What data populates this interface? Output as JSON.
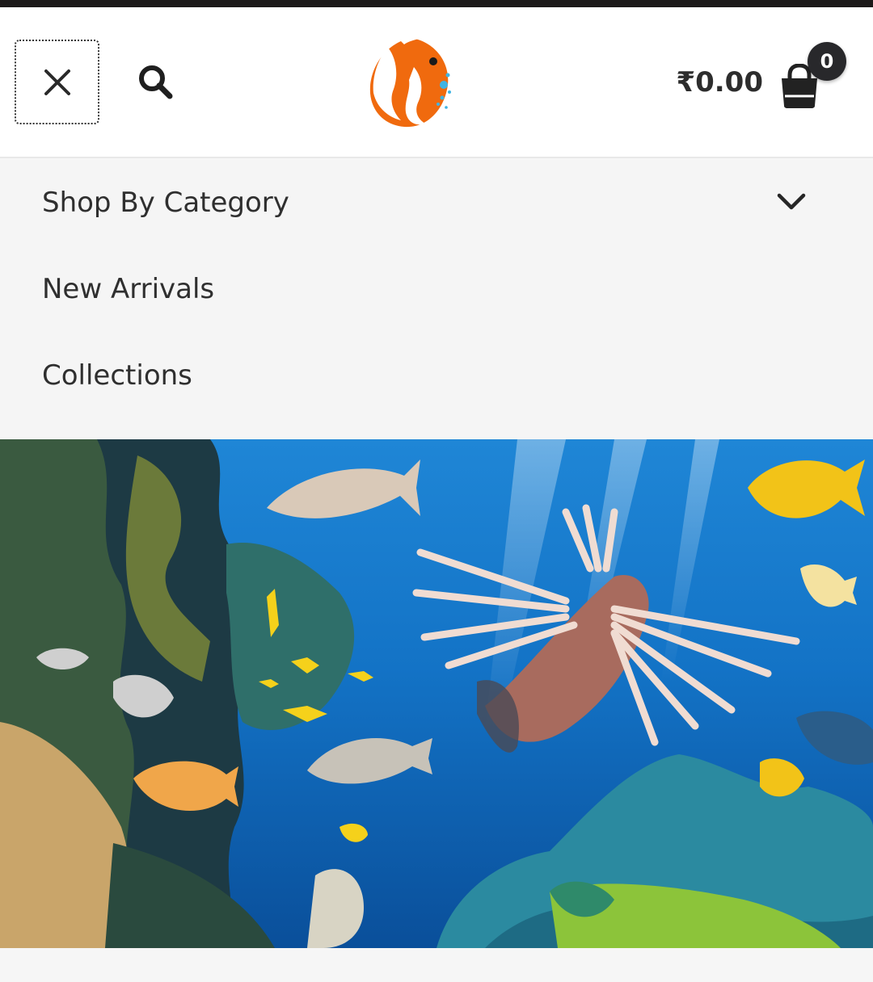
{
  "header": {
    "cart_total": "₹0.00",
    "cart_count": "0",
    "logo_icon": "clownfish-logo-icon",
    "close_icon": "close-icon",
    "search_icon": "search-icon",
    "cart_icon": "shopping-bag-icon"
  },
  "menu": {
    "items": [
      {
        "label": "Shop By Category",
        "has_submenu": true,
        "icon": "chevron-down-icon"
      },
      {
        "label": "New Arrivals"
      },
      {
        "label": "Collections"
      }
    ]
  },
  "hero": {
    "alt": "underwater coral reef with lionfish and tropical fish"
  },
  "colors": {
    "top_strip": "#1c1a19",
    "menu_bg": "#f5f5f5",
    "logo_orange": "#f06a0e",
    "badge": "#28282b",
    "ocean": "#1170c9"
  }
}
